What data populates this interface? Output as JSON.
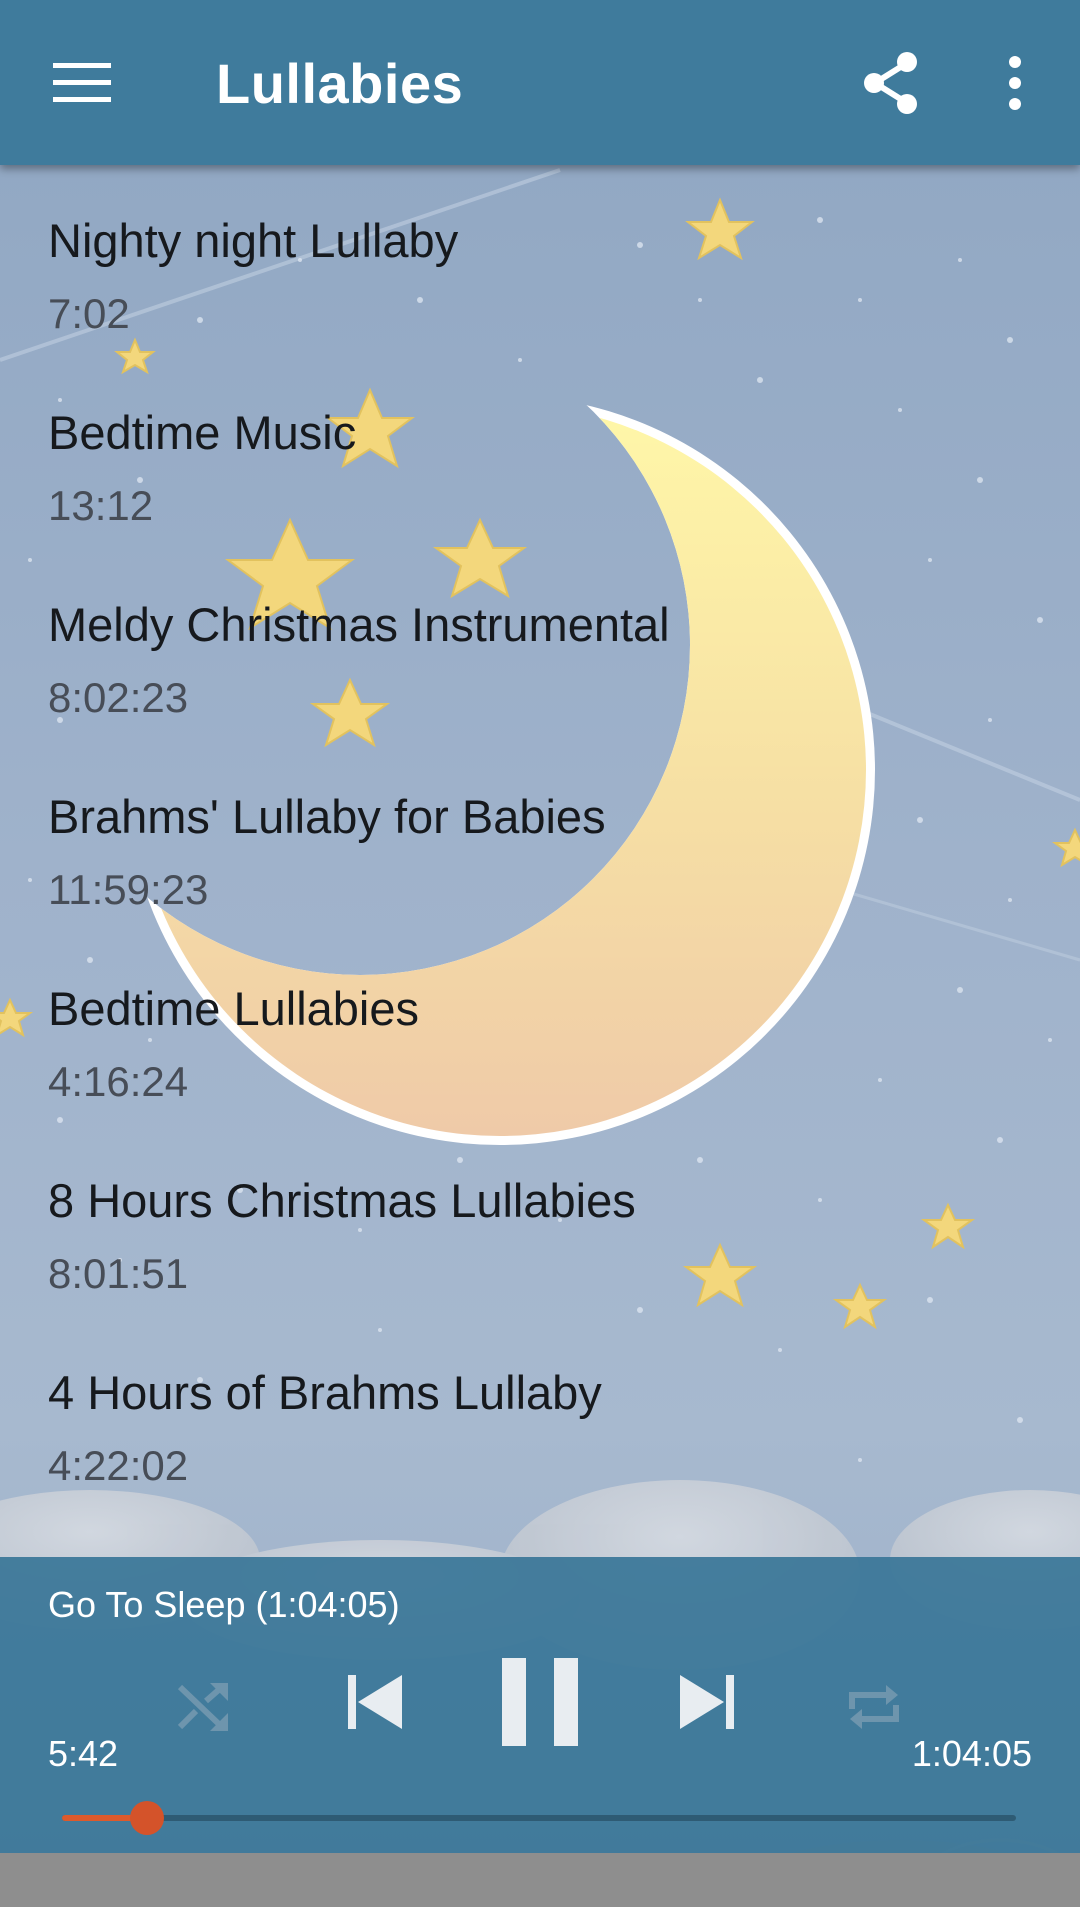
{
  "app_bar": {
    "title": "Lullabies",
    "menu_icon": "hamburger-menu-icon",
    "share_icon": "share-icon",
    "overflow_icon": "more-vert-icon",
    "background_color": "#3f7b9c"
  },
  "tracks": [
    {
      "title": "Nighty night Lullaby",
      "duration": "7:02"
    },
    {
      "title": "Bedtime Music",
      "duration": "13:12"
    },
    {
      "title": "Meldy Christmas Instrumental",
      "duration": "8:02:23"
    },
    {
      "title": "Brahms' Lullaby for Babies",
      "duration": "11:59:23"
    },
    {
      "title": "Bedtime Lullabies",
      "duration": "4:16:24"
    },
    {
      "title": "8 Hours Christmas Lullabies",
      "duration": "8:01:51"
    },
    {
      "title": "4 Hours of Brahms Lullaby",
      "duration": "4:22:02"
    }
  ],
  "player": {
    "now_playing": "Go To Sleep (1:04:05)",
    "elapsed": "5:42",
    "total": "1:04:05",
    "progress": 0.089,
    "shuffle_enabled": false,
    "repeat_enabled": false,
    "state": "playing",
    "controls": [
      "shuffle-icon",
      "skip-previous-icon",
      "pause-icon",
      "skip-next-icon",
      "repeat-icon"
    ],
    "accent_color": "#dc5a2c",
    "background_color": "#3a7698"
  }
}
